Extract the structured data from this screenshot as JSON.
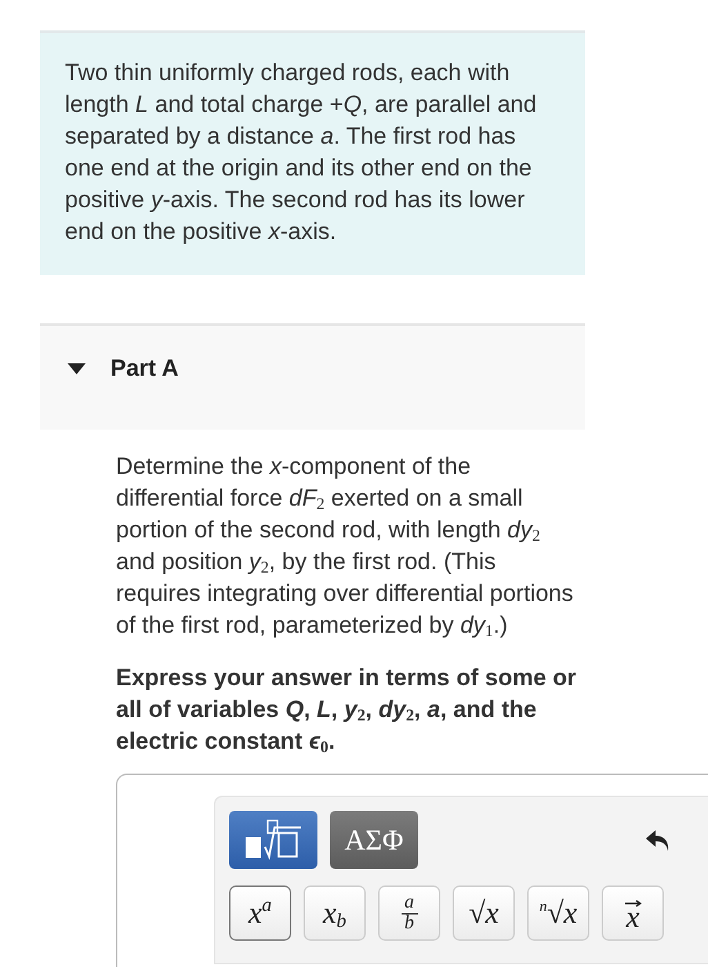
{
  "intro": {
    "text": "Two thin uniformly charged rods, each with length *L* and total charge +*Q*, are parallel and separated by a distance *a*. The first rod has one end at the origin and its other end on the positive *y*-axis. The second rod has its lower end on the positive *x*-axis."
  },
  "part": {
    "title": "Part A",
    "expanded": true
  },
  "question": "Determine the *x*-component of the differential force *dF*$_{2}$ exerted on a small portion of the second rod, with length *dy*$_{2}$ and position *y*$_{2}$, by the first rod. (This requires integrating over differential portions of the first rod, parameterized by *dy*$_{1}$.)",
  "instruction": "Express your answer in terms of some or all of variables *Q*, *L*, *y*$_{2}$, *dy*$_{2}$, *a*, and the electric constant *ϵ*$_{0}$.",
  "palettes": [
    {
      "kind": "templates",
      "selected": true
    },
    {
      "kind": "symbols",
      "label": "ΑΣΦ",
      "selected": false
    }
  ],
  "keys": [
    {
      "kind": "superscript",
      "base": "x",
      "script": "a",
      "selected": true
    },
    {
      "kind": "subscript",
      "base": "x",
      "script": "b",
      "selected": false
    },
    {
      "kind": "fraction",
      "top": "a",
      "bottom": "b",
      "selected": false
    },
    {
      "kind": "root",
      "sign": "√",
      "radicand": "x",
      "selected": false
    },
    {
      "kind": "nroot",
      "index": "n",
      "sign": "√",
      "radicand": "x",
      "selected": false
    },
    {
      "kind": "vector",
      "base": "x",
      "selected": false
    }
  ]
}
